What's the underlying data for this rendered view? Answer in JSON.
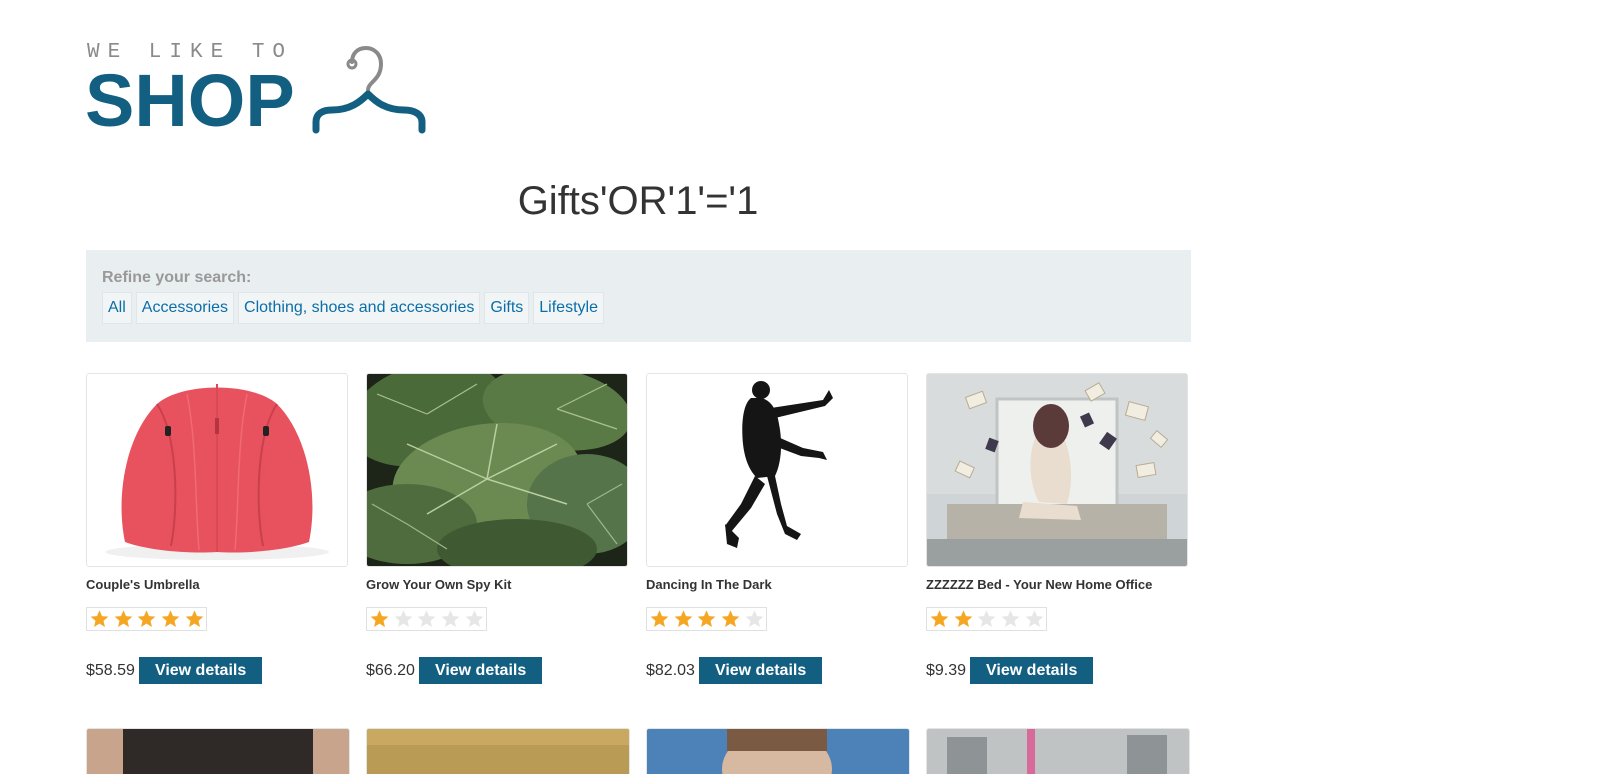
{
  "logo": {
    "small": "WE LIKE TO",
    "big": "SHOP"
  },
  "page_title": "Gifts'OR'1'='1",
  "filter": {
    "label": "Refine your search:",
    "categories": [
      "All",
      "Accessories",
      "Clothing, shoes and accessories",
      "Gifts",
      "Lifestyle"
    ]
  },
  "products": [
    {
      "name": "Couple's Umbrella",
      "rating": 5,
      "price": "$58.59",
      "button": "View details",
      "image": "umbrella"
    },
    {
      "name": "Grow Your Own Spy Kit",
      "rating": 1,
      "price": "$66.20",
      "button": "View details",
      "image": "leaves"
    },
    {
      "name": "Dancing In The Dark",
      "rating": 4,
      "price": "$82.03",
      "button": "View details",
      "image": "silhouette"
    },
    {
      "name": "ZZZZZZ Bed - Your New Home Office",
      "rating": 2,
      "price": "$9.39",
      "button": "View details",
      "image": "books-bed"
    }
  ],
  "colors": {
    "brand": "#135f82",
    "star_on": "#f5a623",
    "star_off": "#e6e6e6",
    "link": "#0b6ea8"
  }
}
